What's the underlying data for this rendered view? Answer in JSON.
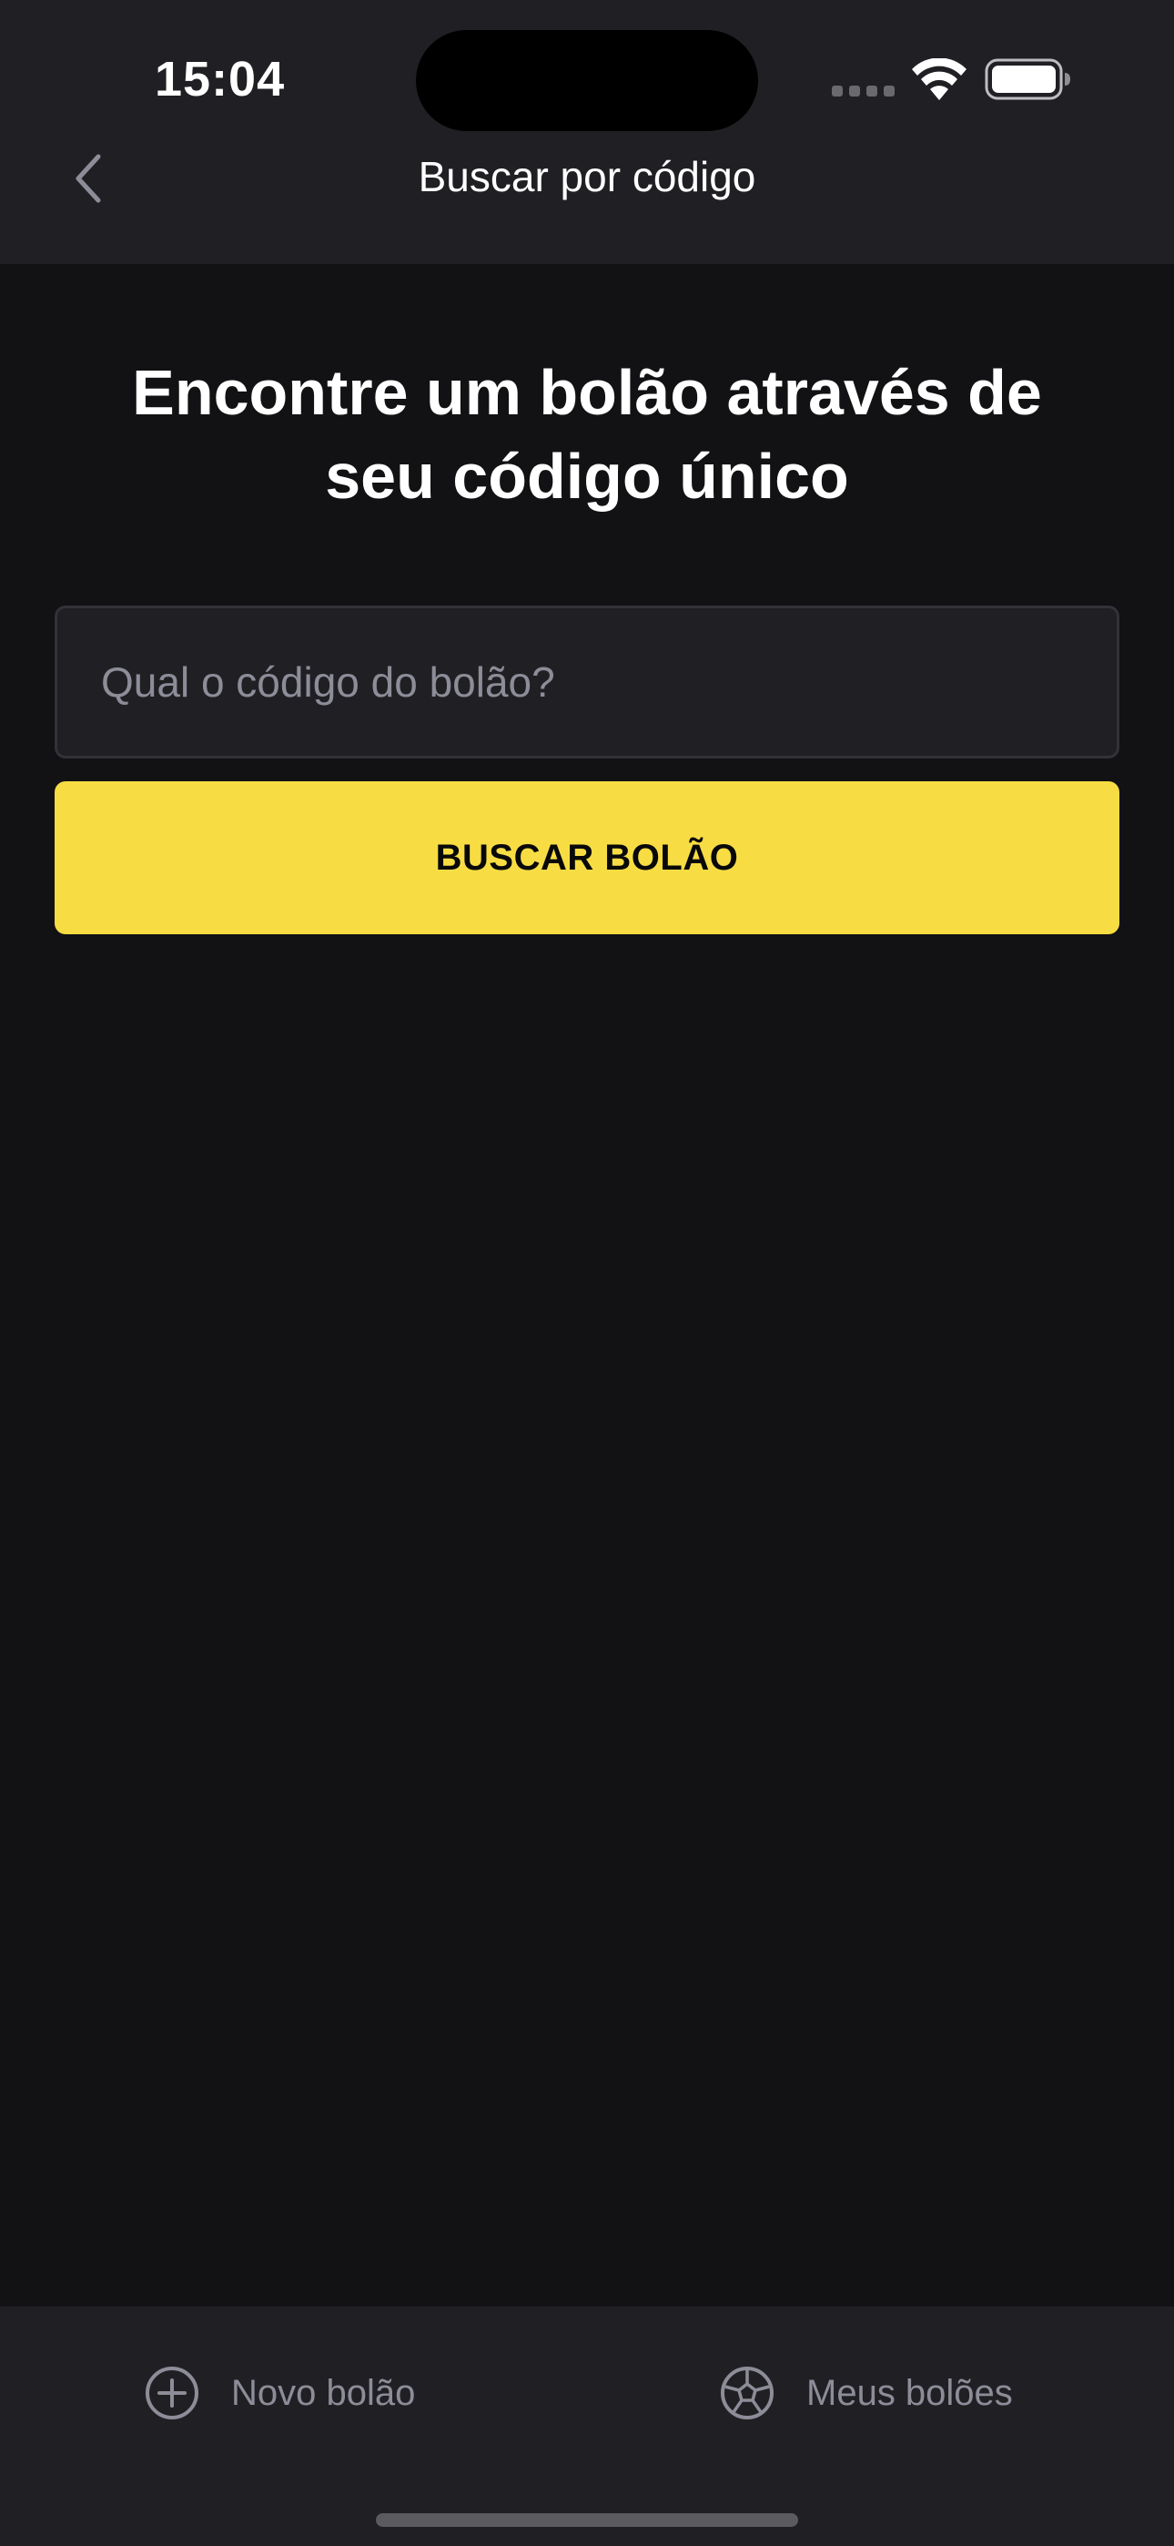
{
  "status_bar": {
    "time": "15:04"
  },
  "header": {
    "title": "Buscar por código",
    "back_icon": "chevron-left-icon"
  },
  "main": {
    "headline": "Encontre um bolão através de seu código único",
    "code_input": {
      "value": "",
      "placeholder": "Qual o código do bolão?"
    },
    "search_button_label": "BUSCAR BOLÃO"
  },
  "tab_bar": {
    "items": [
      {
        "label": "Novo bolão",
        "icon": "plus-circle-icon"
      },
      {
        "label": "Meus bolões",
        "icon": "soccer-ball-icon"
      }
    ]
  },
  "colors": {
    "background": "#121214",
    "surface": "#202024",
    "accent": "#F7DD43",
    "muted_text": "#8D8D99"
  }
}
